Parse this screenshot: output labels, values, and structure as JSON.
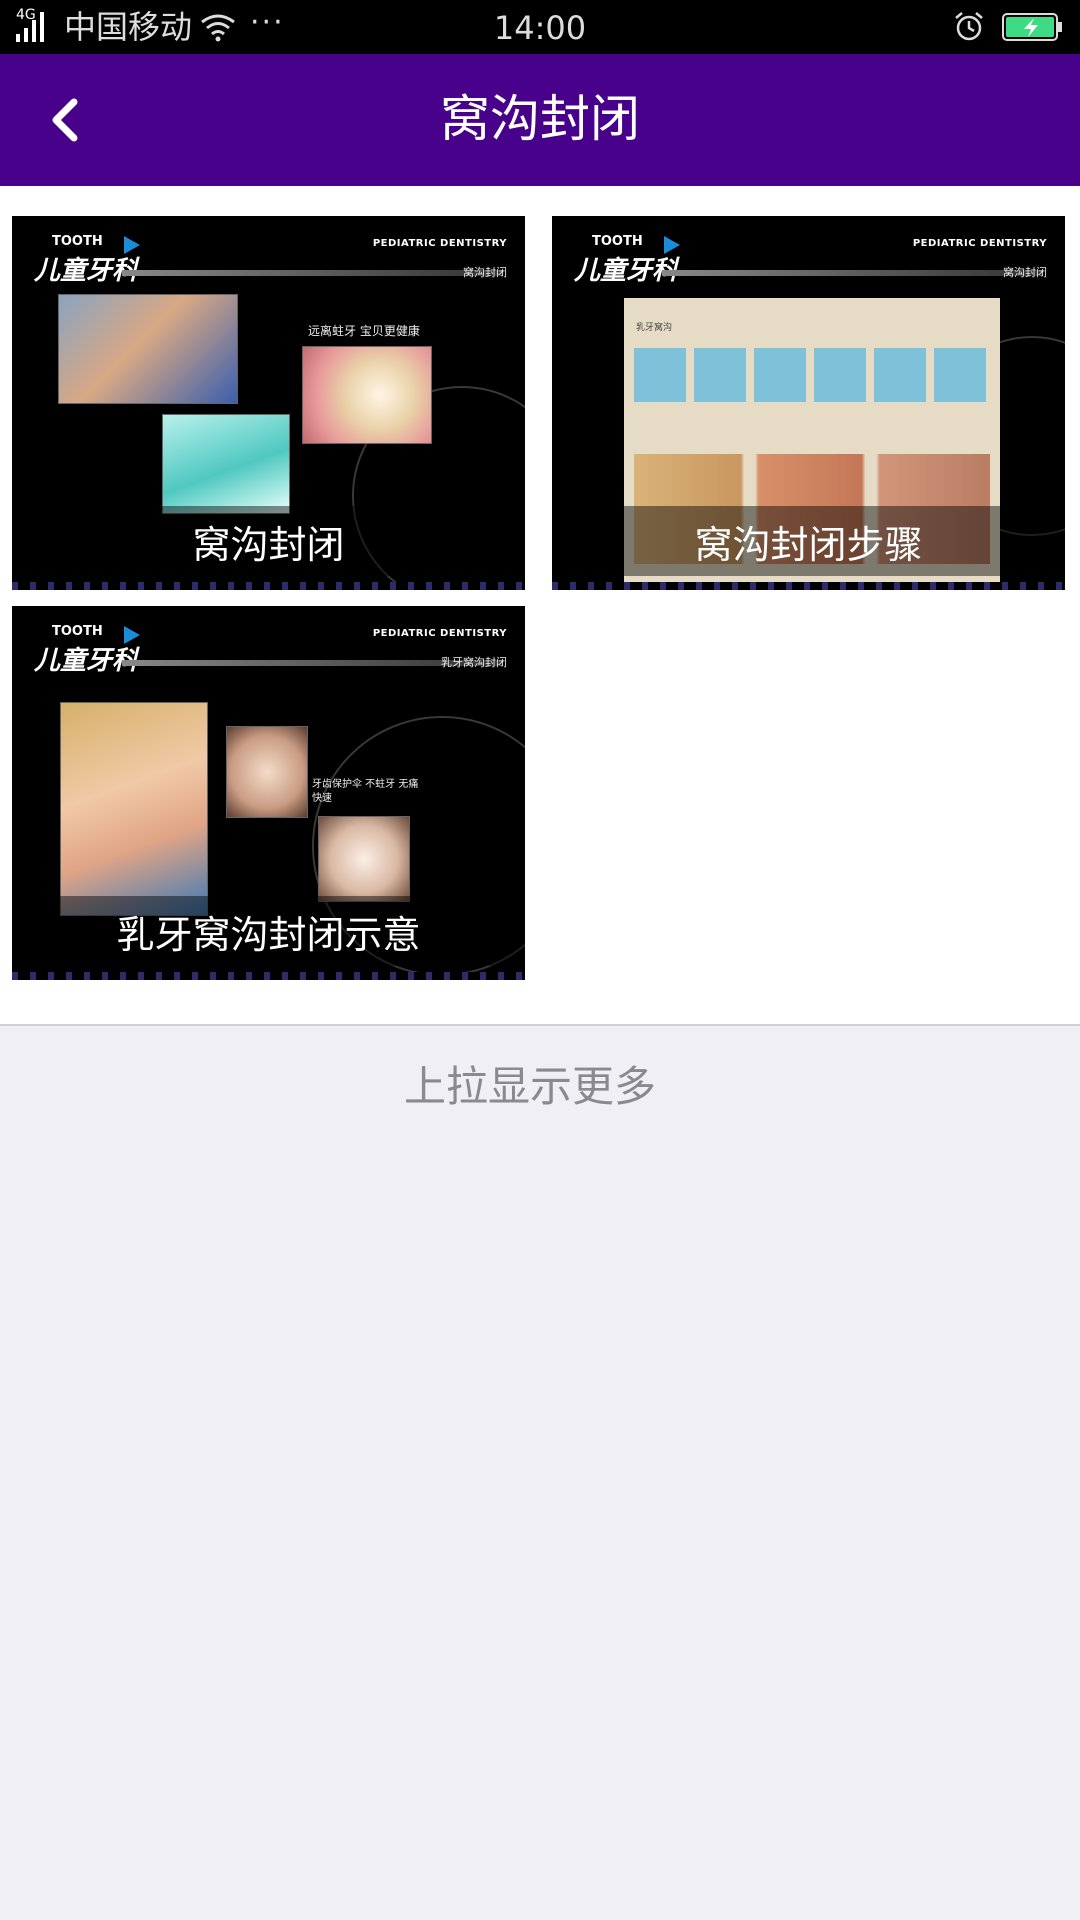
{
  "status_bar": {
    "network": "4G",
    "carrier": "中国移动",
    "more": "···",
    "time": "14:00",
    "icons": [
      "signal-icon",
      "wifi-icon",
      "alarm-icon",
      "battery-charging-icon"
    ]
  },
  "header": {
    "title": "窝沟封闭",
    "back_icon": "chevron-left-icon"
  },
  "colors": {
    "header_bg": "#48018a",
    "status_bar_bg": "#000000",
    "page_bg": "#efeff4",
    "battery_fill": "#3ddc84"
  },
  "videos": [
    {
      "caption": "窝沟封闭",
      "brand_tooth": "TOOTH",
      "brand_main": "儿童牙科",
      "ped_label": "PEDIATRIC DENTISTRY",
      "sub_label": "窝沟封闭",
      "note": "远离蛀牙 宝贝更健康"
    },
    {
      "caption": "窝沟封闭步骤",
      "brand_tooth": "TOOTH",
      "brand_main": "儿童牙科",
      "ped_label": "PEDIATRIC DENTISTRY",
      "sub_label": "窝沟封闭",
      "note": "乳牙窝沟"
    },
    {
      "caption": "乳牙窝沟封闭示意",
      "brand_tooth": "TOOTH",
      "brand_main": "儿童牙科",
      "ped_label": "PEDIATRIC DENTISTRY",
      "sub_label": "乳牙窝沟封闭",
      "note": "牙齿保护伞 不蛀牙 无痛 快速"
    }
  ],
  "footer": {
    "load_more": "上拉显示更多"
  }
}
